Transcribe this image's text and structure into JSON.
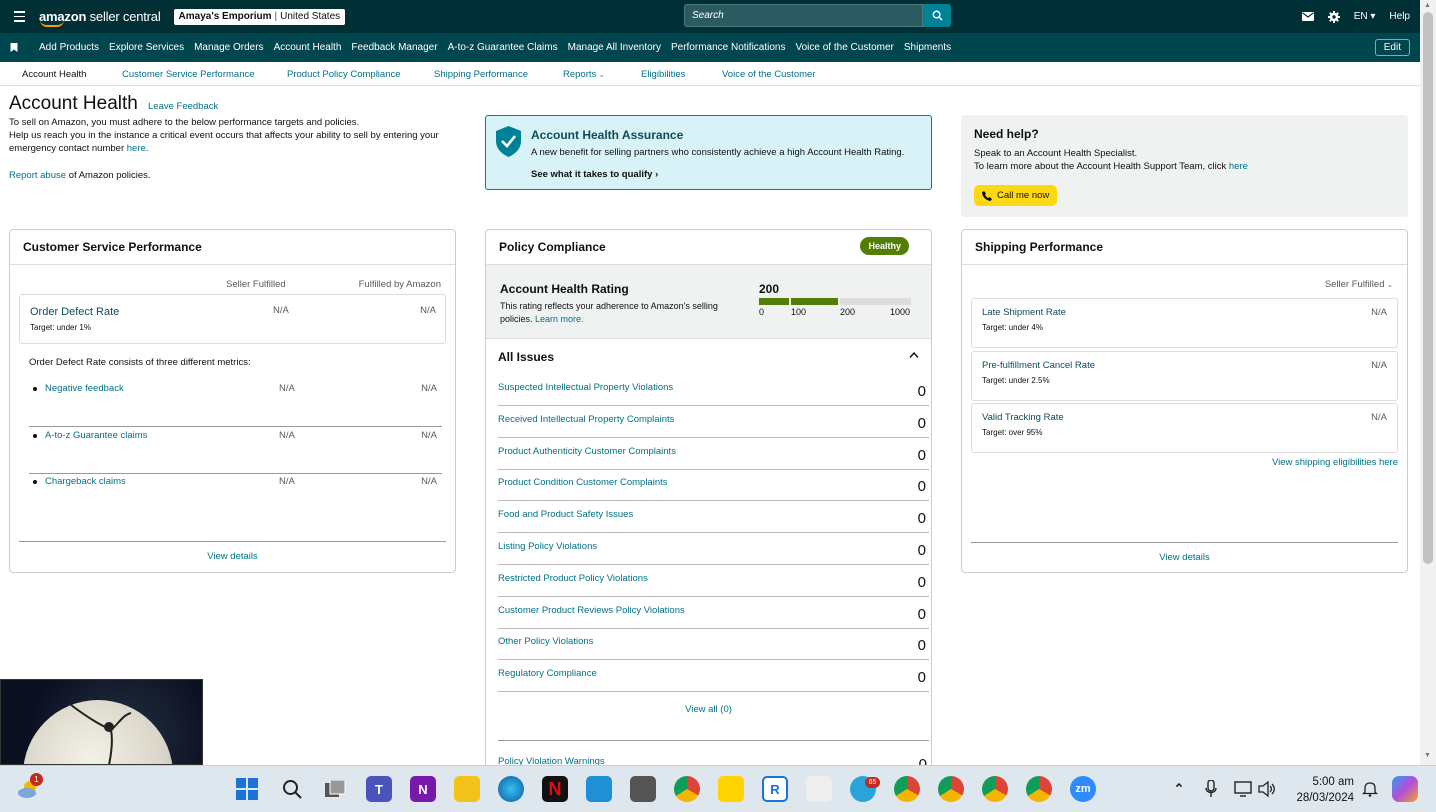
{
  "topbar": {
    "logo_bold": "amazon",
    "logo_light": "seller central",
    "store_name": "Amaya's Emporium",
    "store_region": "United States",
    "search_placeholder": "Search",
    "language": "EN",
    "help": "Help"
  },
  "navbar": {
    "items": [
      "Add Products",
      "Explore Services",
      "Manage Orders",
      "Account Health",
      "Feedback Manager",
      "A-to-z Guarantee Claims",
      "Manage All Inventory",
      "Performance Notifications",
      "Voice of the Customer",
      "Shipments"
    ],
    "edit": "Edit"
  },
  "tabs": [
    "Account Health",
    "Customer Service Performance",
    "Product Policy Compliance",
    "Shipping Performance",
    "Reports",
    "Eligibilities",
    "Voice of the Customer"
  ],
  "header": {
    "title": "Account Health",
    "leave_feedback": "Leave Feedback",
    "intro_1": "To sell on Amazon, you must adhere to the below performance targets and policies.",
    "intro_2": "Help us reach you in the instance a critical event occurs that affects your ability to sell by entering your emergency contact number",
    "intro_link": "here",
    "report_link": "Report abuse",
    "report_rest": "of Amazon policies."
  },
  "assurance": {
    "title": "Account Health Assurance",
    "desc": "A new benefit for selling partners who consistently achieve a high Account Health Rating.",
    "cta": "See what it takes to qualify"
  },
  "help": {
    "title": "Need help?",
    "line1": "Speak to an Account Health Specialist.",
    "line2": "To learn more about the Account Health Support Team, click",
    "line2_link": "here",
    "call": "Call me now"
  },
  "csp": {
    "title": "Customer Service Performance",
    "col1": "Seller Fulfilled",
    "col2": "Fulfilled by Amazon",
    "odr_title": "Order Defect Rate",
    "odr_target": "Target: under 1%",
    "odr_v1": "N/A",
    "odr_v2": "N/A",
    "consists": "Order Defect Rate consists of three different metrics:",
    "metrics": [
      {
        "label": "Negative feedback",
        "v1": "N/A",
        "v2": "N/A"
      },
      {
        "label": "A-to-z Guarantee claims",
        "v1": "N/A",
        "v2": "N/A"
      },
      {
        "label": "Chargeback claims",
        "v1": "N/A",
        "v2": "N/A"
      }
    ],
    "view_details": "View details"
  },
  "pc": {
    "title": "Policy Compliance",
    "badge": "Healthy",
    "ahr_title": "Account Health Rating",
    "ahr_desc": "This rating reflects your adherence to Amazon's selling policies.",
    "ahr_link": "Learn more.",
    "score": "200",
    "score_value": 200,
    "scale_ticks": [
      "0",
      "100",
      "200",
      "1000"
    ],
    "issues_title": "All Issues",
    "issues": [
      {
        "label": "Suspected Intellectual Property Violations",
        "count": "0"
      },
      {
        "label": "Received Intellectual Property Complaints",
        "count": "0"
      },
      {
        "label": "Product Authenticity Customer Complaints",
        "count": "0"
      },
      {
        "label": "Product Condition Customer Complaints",
        "count": "0"
      },
      {
        "label": "Food and Product Safety Issues",
        "count": "0"
      },
      {
        "label": "Listing Policy Violations",
        "count": "0"
      },
      {
        "label": "Restricted Product Policy Violations",
        "count": "0"
      },
      {
        "label": "Customer Product Reviews Policy Violations",
        "count": "0"
      },
      {
        "label": "Other Policy Violations",
        "count": "0"
      },
      {
        "label": "Regulatory Compliance",
        "count": "0"
      }
    ],
    "view_all": "View all (0)",
    "warnings": "Policy Violation Warnings",
    "warnings_count": "0"
  },
  "sp": {
    "title": "Shipping Performance",
    "selector": "Seller Fulfilled",
    "metrics": [
      {
        "label": "Late Shipment Rate",
        "target": "Target: under 4%",
        "value": "N/A"
      },
      {
        "label": "Pre-fulfillment Cancel Rate",
        "target": "Target: under 2.5%",
        "value": "N/A"
      },
      {
        "label": "Valid Tracking Rate",
        "target": "Target: over 95%",
        "value": "N/A"
      }
    ],
    "eligibilities": "View shipping eligibilities here",
    "view_details": "View details"
  },
  "taskbar": {
    "weather_badge": "1",
    "telegram_badge": "65",
    "time": "5:00 am",
    "date": "28/03/2024"
  }
}
